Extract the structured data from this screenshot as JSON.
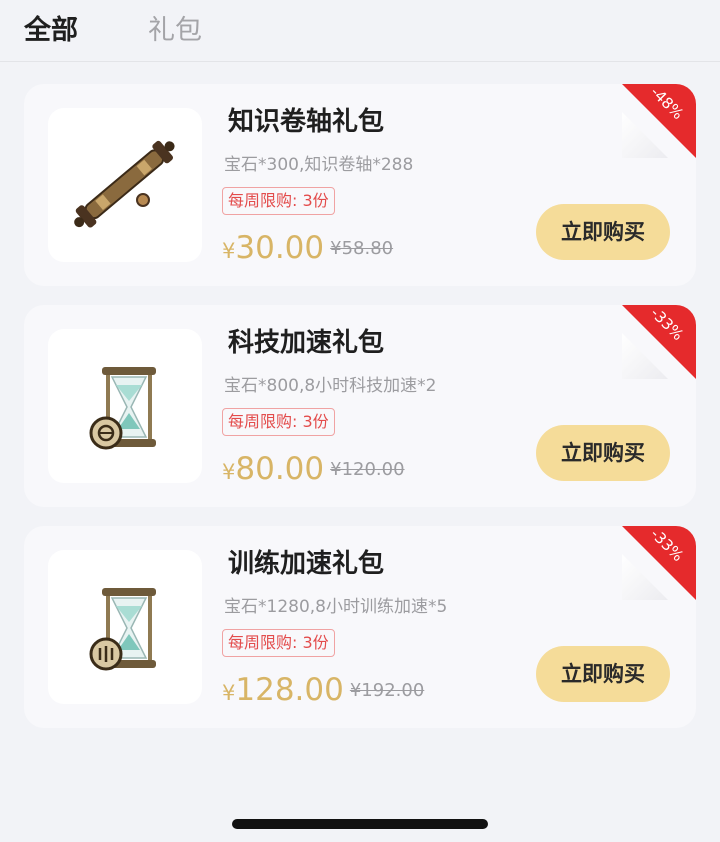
{
  "tabs": [
    {
      "label": "全部",
      "active": true
    },
    {
      "label": "礼包",
      "active": false
    }
  ],
  "accent": {
    "price": "#d8b566",
    "buy_button_bg": "#f5dc99",
    "badge_red": "#e52a2c",
    "limit_red": "#e34c4c"
  },
  "currency_symbol": "¥",
  "buy_label": "立即购买",
  "products": [
    {
      "title": "知识卷轴礼包",
      "contents": "宝石*300,知识卷轴*288",
      "limit": "每周限购: 3份",
      "price": "30.00",
      "original_price": "¥58.80",
      "discount": "-48%",
      "icon": "scroll-icon"
    },
    {
      "title": "科技加速礼包",
      "contents": "宝石*800,8小时科技加速*2",
      "limit": "每周限购: 3份",
      "price": "80.00",
      "original_price": "¥120.00",
      "discount": "-33%",
      "icon": "hourglass-tech-icon"
    },
    {
      "title": "训练加速礼包",
      "contents": "宝石*1280,8小时训练加速*5",
      "limit": "每周限购: 3份",
      "price": "128.00",
      "original_price": "¥192.00",
      "discount": "-33%",
      "icon": "hourglass-training-icon"
    }
  ]
}
